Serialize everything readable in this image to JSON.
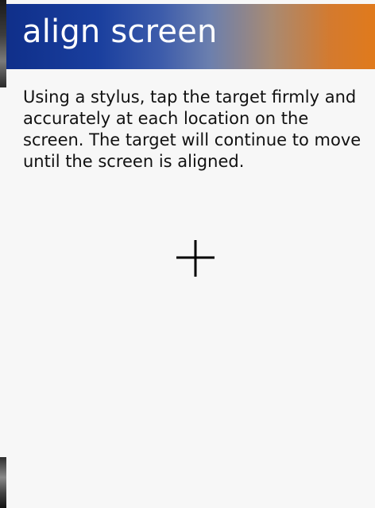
{
  "header": {
    "title": "align screen"
  },
  "content": {
    "instructions": "Using a stylus, tap the target firmly and accurately at each location on the screen. The target will continue to move until the screen is aligned."
  },
  "target": {
    "icon": "crosshair-icon"
  },
  "colors": {
    "title_gradient_start": "#0f2f8a",
    "title_gradient_end": "#e07a1c",
    "title_text": "#ffffff",
    "background": "#f7f7f7",
    "text": "#111111",
    "crosshair": "#000000"
  }
}
